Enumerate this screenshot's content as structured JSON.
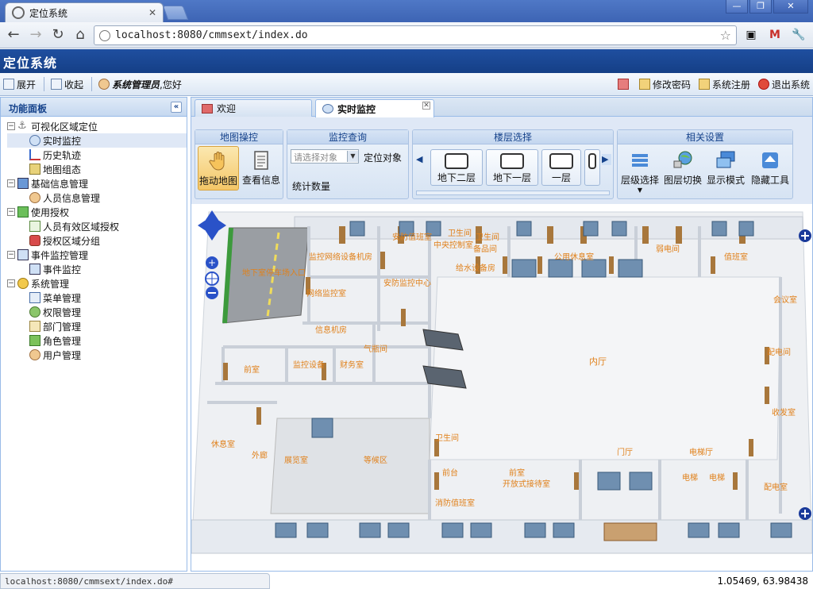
{
  "browser": {
    "tab_title": "定位系统",
    "url": "localhost:8080/cmmsext/index.do",
    "window_buttons": [
      "—",
      "❐",
      "✕"
    ]
  },
  "app": {
    "title": "定位系统",
    "toolbar": {
      "expand": "展开",
      "collapse": "收起",
      "user": "系统管理员",
      "greeting": ",您好",
      "change_password": "修改密码",
      "register": "系统注册",
      "logout": "退出系统"
    },
    "left_panel": {
      "title": "功能面板",
      "groups": [
        {
          "label": "可视化区域定位",
          "items": [
            "实时监控",
            "历史轨迹",
            "地图组态"
          ]
        },
        {
          "label": "基础信息管理",
          "items": [
            "人员信息管理"
          ]
        },
        {
          "label": "使用授权",
          "items": [
            "人员有效区域授权",
            "授权区域分组"
          ]
        },
        {
          "label": "事件监控管理",
          "items": [
            "事件监控"
          ]
        },
        {
          "label": "系统管理",
          "items": [
            "菜单管理",
            "权限管理",
            "部门管理",
            "角色管理",
            "用户管理"
          ]
        }
      ]
    },
    "tabs": [
      "欢迎",
      "实时监控"
    ],
    "ribbon": {
      "map_ops": {
        "title": "地图操控",
        "drag": "拖动地图",
        "view_info": "查看信息"
      },
      "monitor": {
        "title": "监控查询",
        "select_placeholder": "请选择对象",
        "locate": "定位对象",
        "stats": "统计数量"
      },
      "floors": {
        "title": "楼层选择",
        "items": [
          "地下二层",
          "地下一层",
          "一层"
        ]
      },
      "settings": {
        "title": "相关设置",
        "level": "层级选择",
        "switch": "图层切换",
        "display": "显示模式",
        "hide": "隐藏工具"
      }
    },
    "map_labels": [
      "安防值班室",
      "卫生间",
      "监控网络设备机房",
      "备品间",
      "中央控制室",
      "卫生间",
      "给水设备房",
      "公用休息室",
      "弱电间",
      "安防监控中心",
      "值班室",
      "地下室停车场入口",
      "网络监控室",
      "信息机房",
      "气瓶间",
      "内厅",
      "前室",
      "监控设备",
      "财务室",
      "门厅",
      "电梯厅",
      "电梯",
      "电梯",
      "配电室",
      "休息室",
      "外廊",
      "展览室",
      "等候区",
      "开放式接待室",
      "前台",
      "消防值班室",
      "会议室",
      "卫生间",
      "配电间",
      "收发室",
      "前室"
    ]
  },
  "status": {
    "url": "localhost:8080/cmmsext/index.do#",
    "coords": "1.05469, 63.98438"
  },
  "colors": {
    "header_blue": "#1b4893",
    "panel_border": "#99bbe8",
    "label_orange": "#e0801a",
    "wall_brown": "#a8773c",
    "window_blue": "#6f8fb0"
  }
}
